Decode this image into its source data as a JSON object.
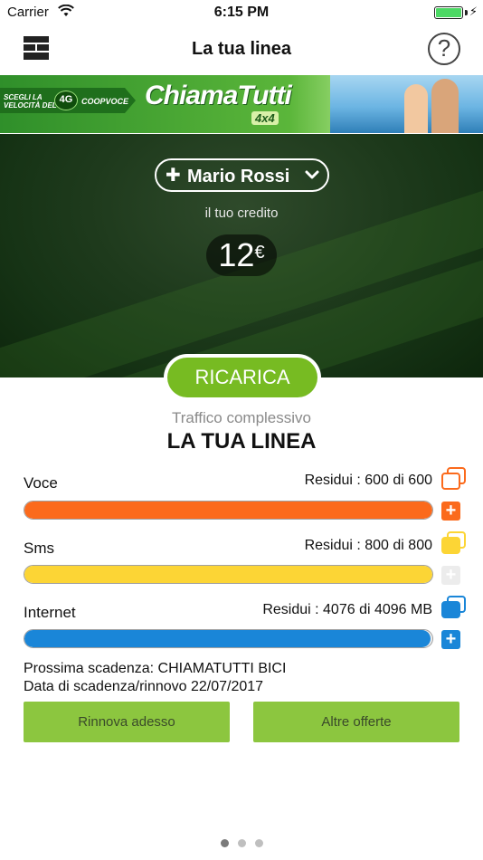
{
  "status_bar": {
    "carrier": "Carrier",
    "time": "6:15 PM"
  },
  "nav": {
    "title": "La tua linea",
    "menu_icon": "wall-menu-icon",
    "help_icon": "question-circle-icon",
    "help_glyph": "?"
  },
  "banner": {
    "promo_text": "SCEGLI LA VELOCITÀ DEL",
    "badge": "4G",
    "brand": "COOPVOCE",
    "logo": "ChiamaTutti",
    "logo_sub": "4x4"
  },
  "hero": {
    "user_name": "Mario Rossi",
    "credit_label": "il tuo credito",
    "credit_amount": "12",
    "credit_currency": "€"
  },
  "recharge_label": "RICARICA",
  "traffic_label": "Traffico complessivo",
  "line_title": "LA TUA LINEA",
  "usage": [
    {
      "label": "Voce",
      "remaining_text": "Residui : 600 di 600",
      "remaining": 600,
      "total": 600,
      "color": "#fb6a1c"
    },
    {
      "label": "Sms",
      "remaining_text": "Residui : 800 di 800",
      "remaining": 800,
      "total": 800,
      "color": "#fcd535"
    },
    {
      "label": "Internet",
      "remaining_text": "Residui : 4076 di 4096 MB",
      "remaining": 4076,
      "total": 4096,
      "color": "#1a86d8"
    }
  ],
  "expiry": {
    "next": "Prossima scadenza: CHIAMATUTTI BICI",
    "date": "Data di scadenza/rinnovo 22/07/2017"
  },
  "buttons": {
    "renew": "Rinnova adesso",
    "offers": "Altre offerte"
  },
  "pages": {
    "count": 3,
    "active": 1
  }
}
